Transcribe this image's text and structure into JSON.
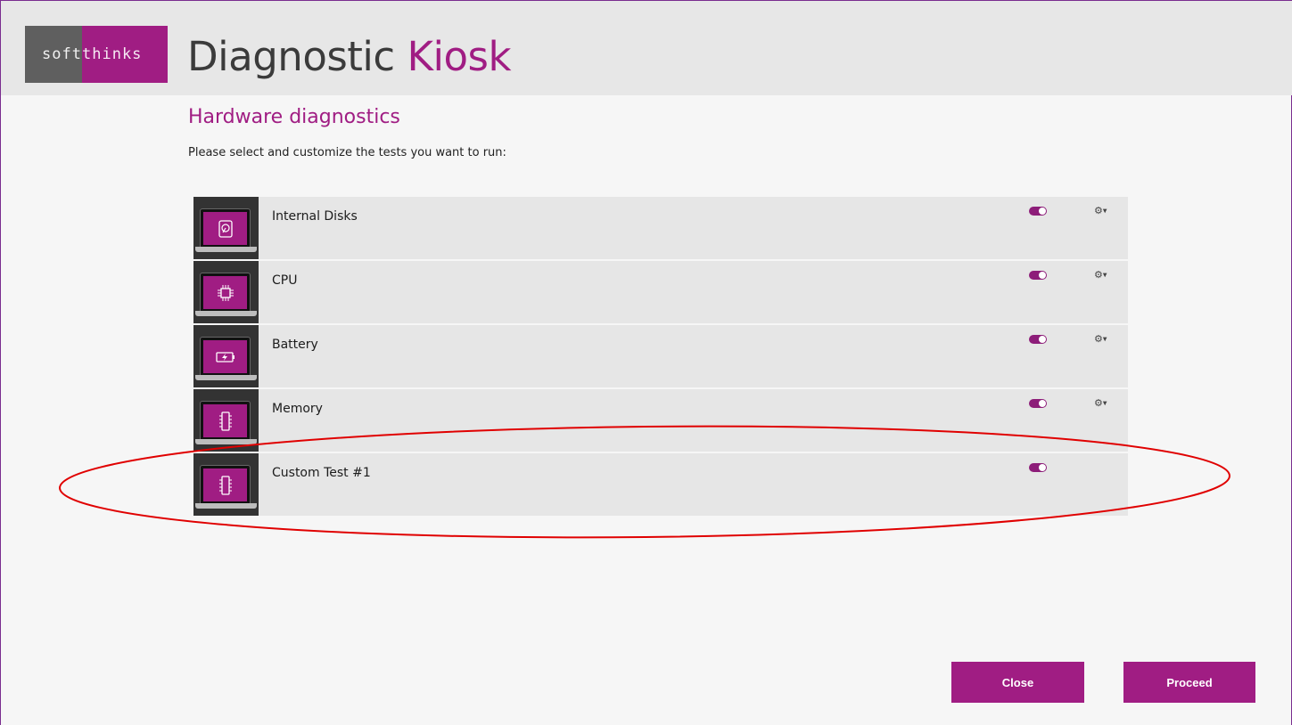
{
  "header": {
    "logo_part1": "soft",
    "logo_part2": "thinks",
    "title_main": "Diagnostic",
    "title_accent": "Kiosk"
  },
  "page": {
    "title": "Hardware diagnostics",
    "instruction": "Please select and customize the tests you want to run:"
  },
  "tests": [
    {
      "label": "Internal Disks",
      "icon": "hard-disk-icon",
      "enabled": true,
      "has_settings": true
    },
    {
      "label": "CPU",
      "icon": "cpu-chip-icon",
      "enabled": true,
      "has_settings": true
    },
    {
      "label": "Battery",
      "icon": "battery-icon",
      "enabled": true,
      "has_settings": true
    },
    {
      "label": "Memory",
      "icon": "memory-module-icon",
      "enabled": true,
      "has_settings": true
    },
    {
      "label": "Custom Test #1",
      "icon": "memory-module-icon",
      "enabled": true,
      "has_settings": false
    }
  ],
  "buttons": {
    "close": "Close",
    "proceed": "Proceed"
  },
  "colors": {
    "accent": "#a01d83",
    "header_bg": "#e7e7e7",
    "row_bg": "#e6e6e6",
    "annotation": "#e00000"
  }
}
